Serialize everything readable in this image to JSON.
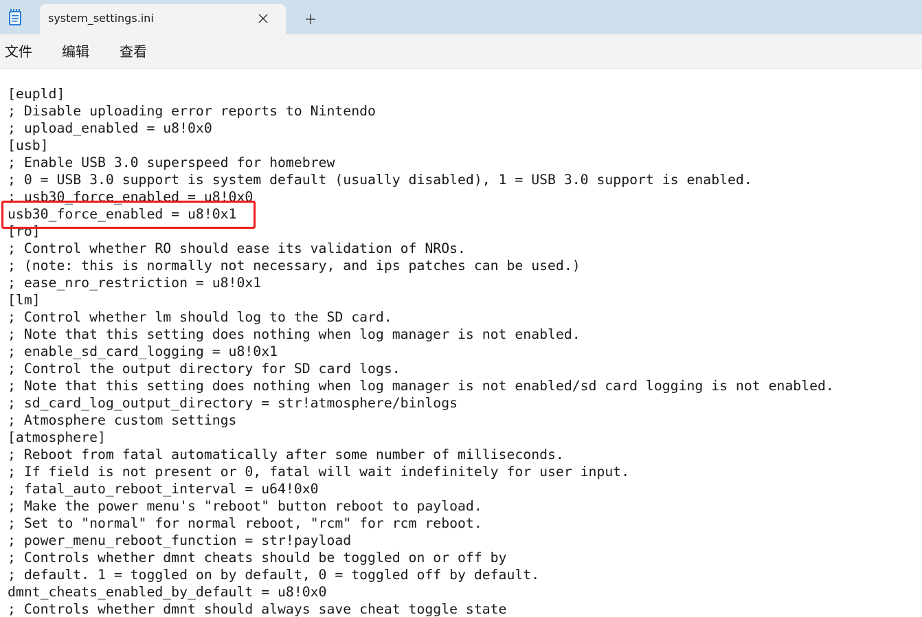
{
  "window": {
    "tab_title": "system_settings.ini",
    "new_tab_symbol": "+",
    "icons": {
      "app": "notepad-icon",
      "close": "close-icon",
      "add": "plus-icon"
    }
  },
  "menubar": {
    "file": "文件",
    "edit": "编辑",
    "view": "查看"
  },
  "editor": {
    "lines": [
      "[eupld]",
      "; Disable uploading error reports to Nintendo",
      "; upload_enabled = u8!0x0",
      "[usb]",
      "; Enable USB 3.0 superspeed for homebrew",
      "; 0 = USB 3.0 support is system default (usually disabled), 1 = USB 3.0 support is enabled.",
      "; usb30_force_enabled = u8!0x0",
      "usb30_force_enabled = u8!0x1",
      "[ro]",
      "; Control whether RO should ease its validation of NROs.",
      "; (note: this is normally not necessary, and ips patches can be used.)",
      "; ease_nro_restriction = u8!0x1",
      "[lm]",
      "; Control whether lm should log to the SD card.",
      "; Note that this setting does nothing when log manager is not enabled.",
      "; enable_sd_card_logging = u8!0x1",
      "; Control the output directory for SD card logs.",
      "; Note that this setting does nothing when log manager is not enabled/sd card logging is not enabled.",
      "; sd_card_log_output_directory = str!atmosphere/binlogs",
      "; Atmosphere custom settings",
      "[atmosphere]",
      "; Reboot from fatal automatically after some number of milliseconds.",
      "; If field is not present or 0, fatal will wait indefinitely for user input.",
      "; fatal_auto_reboot_interval = u64!0x0",
      "; Make the power menu's \"reboot\" button reboot to payload.",
      "; Set to \"normal\" for normal reboot, \"rcm\" for rcm reboot.",
      "; power_menu_reboot_function = str!payload",
      "; Controls whether dmnt cheats should be toggled on or off by",
      "; default. 1 = toggled on by default, 0 = toggled off by default.",
      "dmnt_cheats_enabled_by_default = u8!0x0",
      "; Controls whether dmnt should always save cheat toggle state"
    ],
    "highlight_color": "#ee1c1c"
  }
}
